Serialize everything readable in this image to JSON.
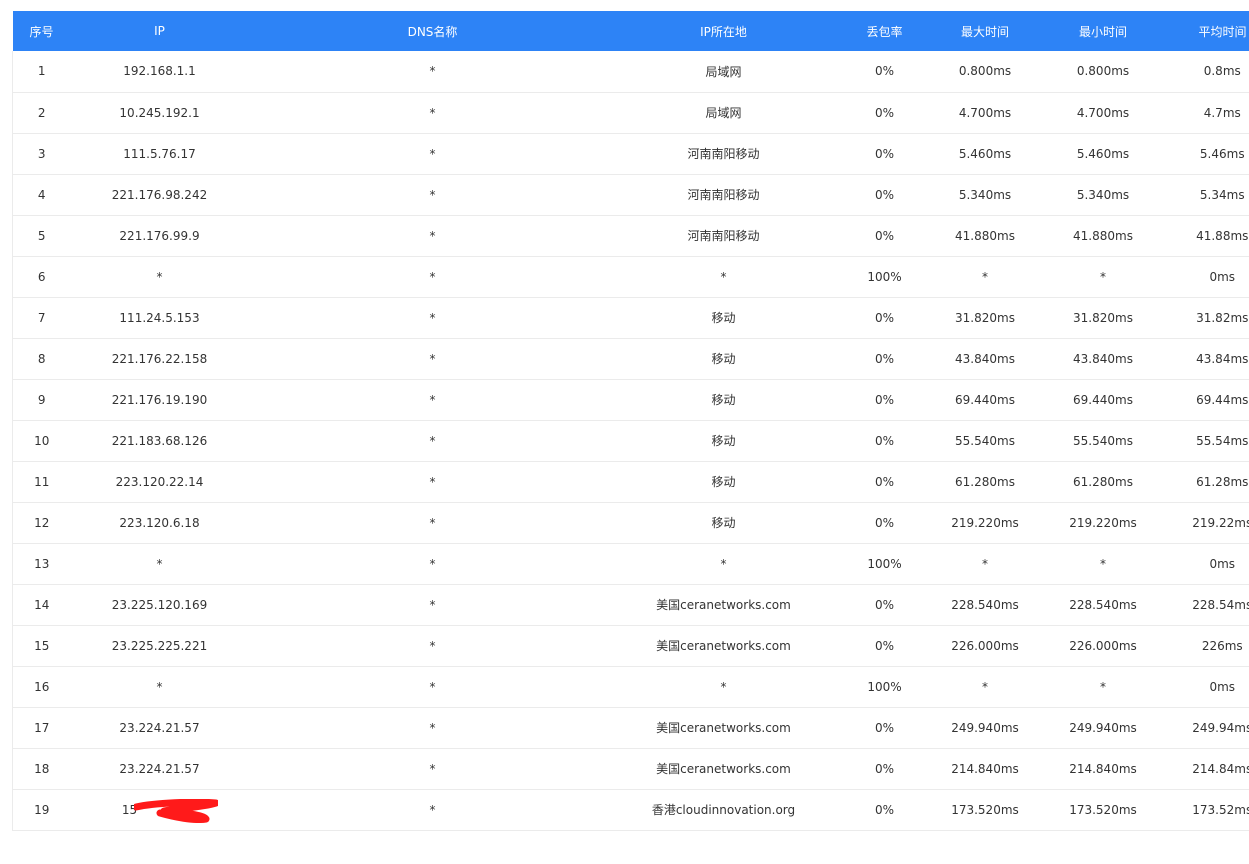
{
  "table": {
    "headers": [
      "序号",
      "IP",
      "DNS名称",
      "IP所在地",
      "丢包率",
      "最大时间",
      "最小时间",
      "平均时间"
    ],
    "rows": [
      [
        "1",
        "192.168.1.1",
        "*",
        "局域网",
        "0%",
        "0.800ms",
        "0.800ms",
        "0.8ms"
      ],
      [
        "2",
        "10.245.192.1",
        "*",
        "局域网",
        "0%",
        "4.700ms",
        "4.700ms",
        "4.7ms"
      ],
      [
        "3",
        "111.5.76.17",
        "*",
        "河南南阳移动",
        "0%",
        "5.460ms",
        "5.460ms",
        "5.46ms"
      ],
      [
        "4",
        "221.176.98.242",
        "*",
        "河南南阳移动",
        "0%",
        "5.340ms",
        "5.340ms",
        "5.34ms"
      ],
      [
        "5",
        "221.176.99.9",
        "*",
        "河南南阳移动",
        "0%",
        "41.880ms",
        "41.880ms",
        "41.88ms"
      ],
      [
        "6",
        "*",
        "*",
        "*",
        "100%",
        "*",
        "*",
        "0ms"
      ],
      [
        "7",
        "111.24.5.153",
        "*",
        "移动",
        "0%",
        "31.820ms",
        "31.820ms",
        "31.82ms"
      ],
      [
        "8",
        "221.176.22.158",
        "*",
        "移动",
        "0%",
        "43.840ms",
        "43.840ms",
        "43.84ms"
      ],
      [
        "9",
        "221.176.19.190",
        "*",
        "移动",
        "0%",
        "69.440ms",
        "69.440ms",
        "69.44ms"
      ],
      [
        "10",
        "221.183.68.126",
        "*",
        "移动",
        "0%",
        "55.540ms",
        "55.540ms",
        "55.54ms"
      ],
      [
        "11",
        "223.120.22.14",
        "*",
        "移动",
        "0%",
        "61.280ms",
        "61.280ms",
        "61.28ms"
      ],
      [
        "12",
        "223.120.6.18",
        "*",
        "移动",
        "0%",
        "219.220ms",
        "219.220ms",
        "219.22ms"
      ],
      [
        "13",
        "*",
        "*",
        "*",
        "100%",
        "*",
        "*",
        "0ms"
      ],
      [
        "14",
        "23.225.120.169",
        "*",
        "美国ceranetworks.com",
        "0%",
        "228.540ms",
        "228.540ms",
        "228.54ms"
      ],
      [
        "15",
        "23.225.225.221",
        "*",
        "美国ceranetworks.com",
        "0%",
        "226.000ms",
        "226.000ms",
        "226ms"
      ],
      [
        "16",
        "*",
        "*",
        "*",
        "100%",
        "*",
        "*",
        "0ms"
      ],
      [
        "17",
        "23.224.21.57",
        "*",
        "美国ceranetworks.com",
        "0%",
        "249.940ms",
        "249.940ms",
        "249.94ms"
      ],
      [
        "18",
        "23.224.21.57",
        "*",
        "美国ceranetworks.com",
        "0%",
        "214.840ms",
        "214.840ms",
        "214.84ms"
      ],
      [
        "19",
        "15",
        "*",
        "香港cloudinnovation.org",
        "0%",
        "173.520ms",
        "173.520ms",
        "173.52ms"
      ]
    ],
    "redacted_row_index": 18
  },
  "colors": {
    "header_bg": "#2d83f6",
    "header_text": "#ffffff",
    "redaction": "#ff1a1a"
  }
}
